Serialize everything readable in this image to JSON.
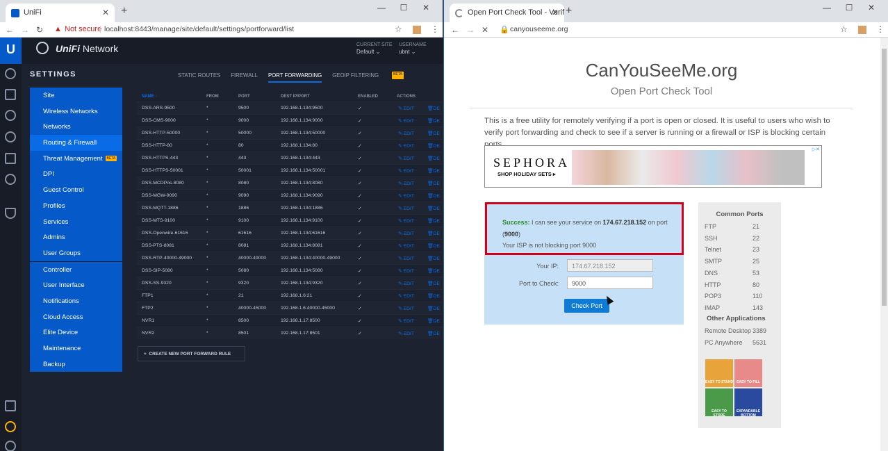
{
  "left_browser": {
    "tab_title": "UniFi",
    "url_warning": "Not secure",
    "url": "localhost:8443/manage/site/default/settings/portforward/list"
  },
  "unifi": {
    "brand_prefix": "UniFi",
    "brand_suffix": "Network",
    "current_site_label": "CURRENT SITE",
    "current_site_value": "Default",
    "username_label": "USERNAME",
    "username_value": "ubnt",
    "settings_heading": "SETTINGS",
    "sidebar_group1": [
      "Site",
      "Wireless Networks",
      "Networks",
      "Routing & Firewall",
      "Threat Management",
      "DPI",
      "Guest Control",
      "Profiles",
      "Services",
      "Admins",
      "User Groups"
    ],
    "sidebar_group2": [
      "Controller",
      "User Interface",
      "Notifications",
      "Cloud Access",
      "Elite Device",
      "Maintenance",
      "Backup"
    ],
    "beta_label": "BETA",
    "subtabs": [
      "STATIC ROUTES",
      "FIREWALL",
      "PORT FORWARDING",
      "GEOIP FILTERING"
    ],
    "columns": {
      "name": "NAME",
      "from": "FROM",
      "port": "PORT",
      "dest": "DEST IP/PORT",
      "enabled": "ENABLED",
      "actions": "ACTIONS"
    },
    "edit_label": "EDIT",
    "delete_label": "DE",
    "rows": [
      [
        "DSS-ARS-9500",
        "*",
        "9500",
        "192.168.1.134:9500"
      ],
      [
        "DSS-CMS-9000",
        "*",
        "9000",
        "192.168.1.134:9000"
      ],
      [
        "DSS-HTTP-50000",
        "*",
        "50000",
        "192.168.1.134:50000"
      ],
      [
        "DSS-HTTP-80",
        "*",
        "80",
        "192.168.1.134:80"
      ],
      [
        "DSS-HTTPS-443",
        "*",
        "443",
        "192.168.1.134:443"
      ],
      [
        "DSS-HTTPS-50001",
        "*",
        "50001",
        "192.168.1.134:50001"
      ],
      [
        "DSS-MCDPos-8080",
        "*",
        "8080",
        "192.168.1.134:8080"
      ],
      [
        "DSS-MGW-9090",
        "*",
        "9090",
        "192.168.1.134:9090"
      ],
      [
        "DSS-MQTT-1886",
        "*",
        "1886",
        "192.168.1.134:1886"
      ],
      [
        "DSS-MTS-9100",
        "*",
        "9100",
        "192.168.1.134:9100"
      ],
      [
        "DSS-Openwire-61616",
        "*",
        "61616",
        "192.168.1.134:61616"
      ],
      [
        "DSS-PTS-8081",
        "*",
        "8081",
        "192.168.1.134:8081"
      ],
      [
        "DSS-RTP-40000-49000",
        "*",
        "40000-49000",
        "192.168.1.134:40000-49000"
      ],
      [
        "DSS-SIP-5080",
        "*",
        "5080",
        "192.168.1.134:5080"
      ],
      [
        "DSS-SS-9320",
        "*",
        "9320",
        "192.168.1.134:9320"
      ],
      [
        "FTP1",
        "*",
        "21",
        "192.168.1.6:21"
      ],
      [
        "FTP2",
        "*",
        "40000-45000",
        "192.168.1.6:40000-45000"
      ],
      [
        "NVR1",
        "*",
        "8500",
        "192.168.1.17:8500"
      ],
      [
        "NVR2",
        "*",
        "8501",
        "192.168.1.17:8501"
      ]
    ],
    "create_button": "CREATE NEW PORT FORWARD RULE"
  },
  "right_browser": {
    "tab_title": "Open Port Check Tool - Verify P",
    "url": "canyouseeme.org"
  },
  "cysm": {
    "title": "CanYouSeeMe.org",
    "subtitle": "Open Port Check Tool",
    "intro": "This is a free utility for remotely verifying if a port is open or closed. It is useful to users who wish to verify port forwarding and check to see if a server is running or a firewall or ISP is blocking certain ports.",
    "ad_brand": "SEPHORA",
    "ad_cta": "SHOP HOLIDAY SETS ▸",
    "success_label": "Success:",
    "success_text1": " I can see your service on ",
    "success_ip": "174.67.218.152",
    "success_text2": " on port (",
    "success_port": "9000",
    "success_text3": ")",
    "success_line2": "Your ISP is not blocking port 9000",
    "your_ip_label": "Your IP:",
    "your_ip_value": "174.67.218.152",
    "port_label": "Port to Check:",
    "port_value": "9000",
    "check_button": "Check Port",
    "common_ports_title": "Common Ports",
    "common_ports": [
      [
        "FTP",
        "21"
      ],
      [
        "SSH",
        "22"
      ],
      [
        "Telnet",
        "23"
      ],
      [
        "SMTP",
        "25"
      ],
      [
        "DNS",
        "53"
      ],
      [
        "HTTP",
        "80"
      ],
      [
        "POP3",
        "110"
      ],
      [
        "IMAP",
        "143"
      ]
    ],
    "other_apps_title": "Other Applications",
    "other_apps": [
      [
        "Remote Desktop",
        "3389"
      ],
      [
        "PC Anywhere",
        "5631"
      ]
    ],
    "ad2_labels": [
      "EASY TO STAND",
      "EASY TO FILL",
      "EASY TO STORE",
      "EXPANDABLE BOTTOM"
    ]
  }
}
